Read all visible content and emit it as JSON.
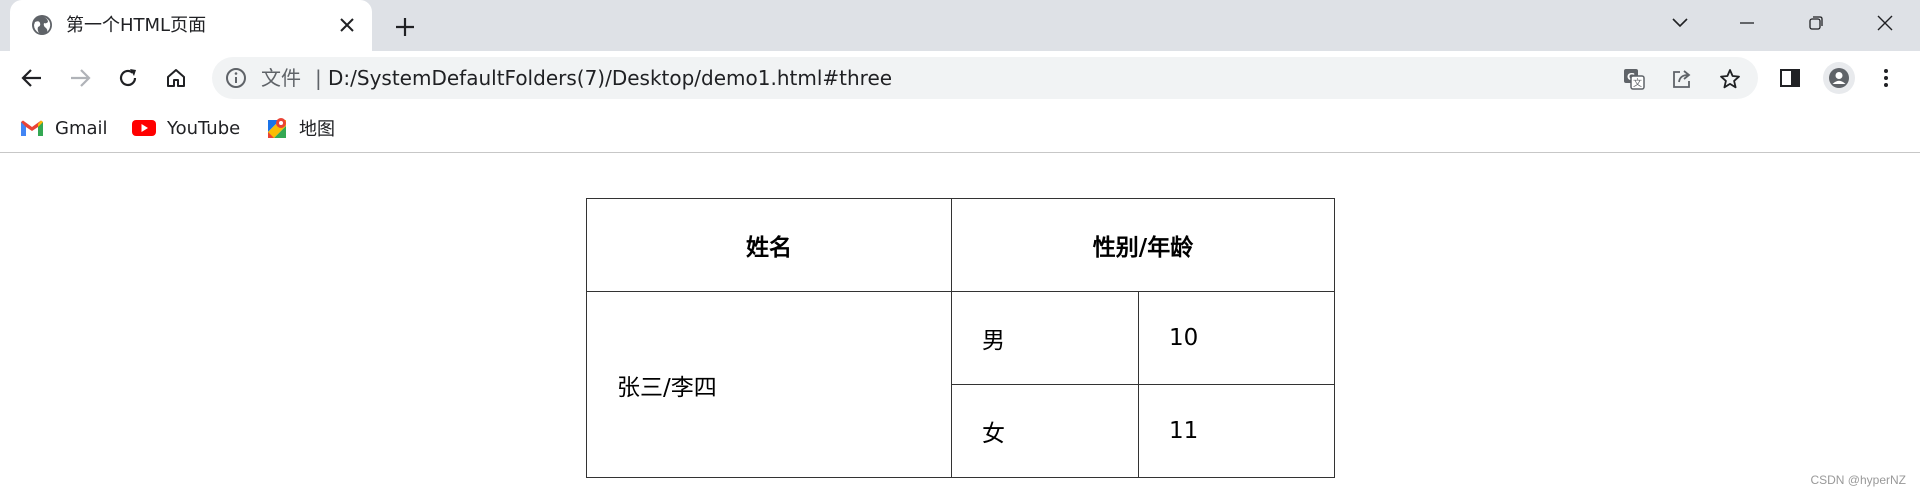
{
  "tab": {
    "title": "第一个HTML页面",
    "favicon": "globe-icon",
    "close": "close-icon"
  },
  "window_controls": [
    "tab-search-icon",
    "minimize-icon",
    "restore-icon",
    "close-icon"
  ],
  "toolbar": {
    "back": "back-arrow-icon",
    "forward": "forward-arrow-icon",
    "reload": "reload-icon",
    "home": "home-icon",
    "omnibox": {
      "info_icon": "info-icon",
      "scheme_label": "文件",
      "separator": "|",
      "url": "D:/SystemDefaultFolders(7)/Desktop/demo1.html#three",
      "right_icons": [
        "translate-icon",
        "share-icon",
        "star-icon"
      ]
    },
    "side_panel": "side-panel-icon",
    "profile": "profile-icon",
    "menu": "kebab-menu-icon"
  },
  "bookmarks": [
    {
      "label": "Gmail",
      "icon": "gmail-icon"
    },
    {
      "label": "YouTube",
      "icon": "youtube-icon"
    },
    {
      "label": "地图",
      "icon": "maps-icon"
    }
  ],
  "table": {
    "headers": [
      "姓名",
      "性别/年龄"
    ],
    "merged_name": "张三/李四",
    "rows": [
      {
        "gender": "男",
        "age": "10"
      },
      {
        "gender": "女",
        "age": "11"
      }
    ]
  },
  "watermark": "CSDN @hyperNZ",
  "colors": {
    "tabstrip": "#dee1e6",
    "omnibox": "#f1f3f4",
    "youtube_red": "#ff0000"
  }
}
